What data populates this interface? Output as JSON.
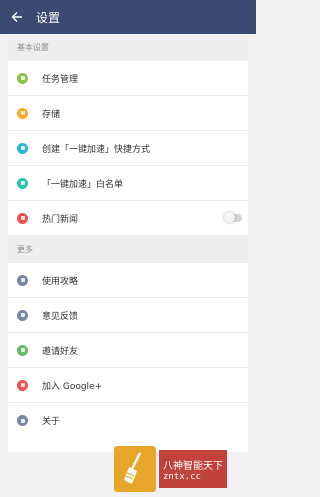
{
  "header": {
    "title": "设置",
    "back_icon": "arrow-left-icon"
  },
  "sections": [
    {
      "title": "基本设置",
      "items": [
        {
          "label": "任务管理",
          "icon": "task-icon",
          "color": "#8bc34a"
        },
        {
          "label": "存储",
          "icon": "storage-icon",
          "color": "#ffa726"
        },
        {
          "label": "创建「一键加速」快捷方式",
          "icon": "shortcut-icon",
          "color": "#29b6d8"
        },
        {
          "label": "「一键加速」白名单",
          "icon": "whitelist-icon",
          "color": "#26c6a6"
        },
        {
          "label": "热门新闻",
          "icon": "news-icon",
          "color": "#ef5350",
          "toggle": false
        }
      ]
    },
    {
      "title": "更多",
      "items": [
        {
          "label": "使用攻略",
          "icon": "help-icon",
          "color": "#7986a3"
        },
        {
          "label": "意见反馈",
          "icon": "feedback-icon",
          "color": "#7986a3"
        },
        {
          "label": "邀请好友",
          "icon": "share-icon",
          "color": "#66bb6a"
        },
        {
          "label": "加入 Google+",
          "icon": "google-plus-icon",
          "color": "#ef5350"
        },
        {
          "label": "关于",
          "icon": "info-icon",
          "color": "#7986a3"
        }
      ]
    }
  ],
  "watermark": {
    "line1": "八神智能天下",
    "line2": "zntx.cc",
    "logo_icon": "broom-logo-icon"
  }
}
